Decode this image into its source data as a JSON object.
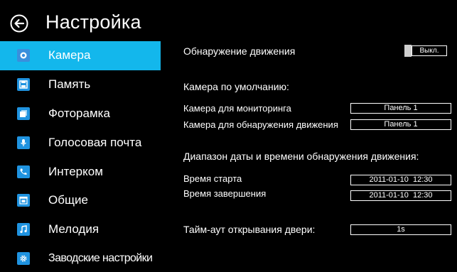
{
  "header": {
    "title": "Настройка"
  },
  "sidebar": {
    "items": [
      {
        "label": "Камера",
        "icon": "camera-icon",
        "active": true
      },
      {
        "label": "Память",
        "icon": "floppy-disk-icon",
        "active": false
      },
      {
        "label": "Фоторамка",
        "icon": "photo-frame-icon",
        "active": false
      },
      {
        "label": "Голосовая почта",
        "icon": "microphone-icon",
        "active": false
      },
      {
        "label": "Интерком",
        "icon": "phone-icon",
        "active": false
      },
      {
        "label": "Общие",
        "icon": "calendar-icon",
        "active": false
      },
      {
        "label": "Мелодия",
        "icon": "music-note-icon",
        "active": false
      },
      {
        "label": "Заводские настройки",
        "icon": "gear-icon",
        "active": false
      }
    ]
  },
  "settings": {
    "motion_detection": {
      "label": "Обнаружение движения",
      "toggle_value": "Выкл."
    },
    "default_camera_heading": "Камера по умолчанию:",
    "monitoring_camera": {
      "label": "Камера для мониторинга",
      "value": "Панель 1"
    },
    "motion_camera": {
      "label": "Камера для обнаружения движения",
      "value": "Панель 1"
    },
    "date_range_heading": "Диапазон даты и времени обнаружения движения:",
    "start_time": {
      "label": "Время старта",
      "value": "2011-01-10  12:30"
    },
    "end_time": {
      "label": "Время завершения",
      "value": "2011-01-10  12:30"
    },
    "door_timeout": {
      "label": "Тайм-аут открывания двери:",
      "value": "1s"
    }
  },
  "colors": {
    "accent": "#13b7ec",
    "icon_bg": "#1f93e0",
    "background": "#000000",
    "text": "#ffffff"
  }
}
